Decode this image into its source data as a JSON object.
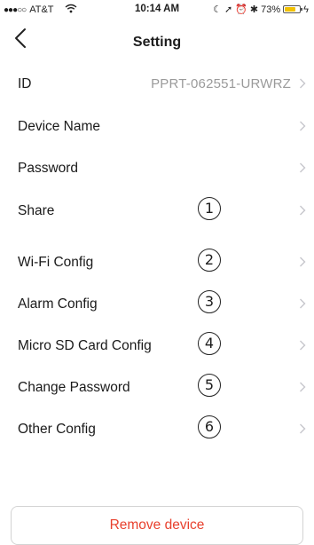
{
  "status_bar": {
    "carrier": "AT&T",
    "time": "10:14 AM",
    "battery_pct": "73%",
    "battery_fraction": 0.73,
    "battery_color": "#f2c100"
  },
  "nav": {
    "title": "Setting",
    "back_icon": "chevron-left-icon"
  },
  "rows": [
    {
      "label": "ID",
      "value": "PPRT-062551-URWRZ"
    },
    {
      "label": "Device Name"
    },
    {
      "label": "Password"
    },
    {
      "label": "Share",
      "marker": "1"
    },
    {
      "label": "Wi-Fi Config",
      "marker": "2"
    },
    {
      "label": "Alarm Config",
      "marker": "3"
    },
    {
      "label": "Micro SD Card Config",
      "marker": "4"
    },
    {
      "label": "Change Password",
      "marker": "5"
    },
    {
      "label": "Other Config",
      "marker": "6"
    }
  ],
  "remove_button": {
    "label": "Remove device",
    "color": "#e8412e"
  },
  "colors": {
    "accent_red": "#e8412e",
    "secondary_text": "#9a9a9a"
  }
}
